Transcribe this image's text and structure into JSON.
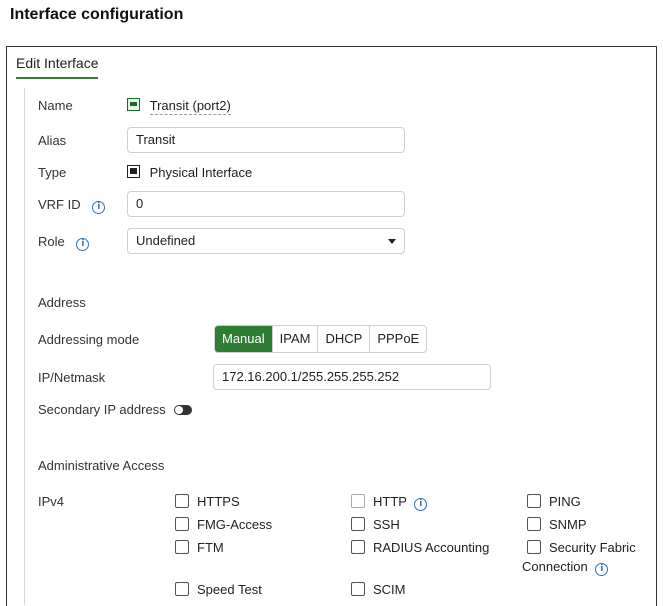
{
  "heading": "Interface configuration",
  "tab": {
    "label": "Edit Interface"
  },
  "fields": {
    "name_label": "Name",
    "name_value": "Transit (port2)",
    "alias_label": "Alias",
    "alias_value": "Transit",
    "type_label": "Type",
    "type_value": "Physical Interface",
    "vrf_label": "VRF ID",
    "vrf_value": "0",
    "role_label": "Role",
    "role_value": "Undefined"
  },
  "address": {
    "section_label": "Address",
    "mode_label": "Addressing mode",
    "modes": [
      "Manual",
      "IPAM",
      "DHCP",
      "PPPoE"
    ],
    "selected_mode": "Manual",
    "ipmask_label": "IP/Netmask",
    "ipmask_value": "172.16.200.1/255.255.255.252",
    "secondary_label": "Secondary IP address",
    "secondary_enabled": false
  },
  "admin": {
    "section_label": "Administrative Access",
    "ipv4_label": "IPv4",
    "options": {
      "https": "HTTPS",
      "http": "HTTP",
      "ping": "PING",
      "fmg": "FMG-Access",
      "ssh": "SSH",
      "snmp": "SNMP",
      "ftm": "FTM",
      "radius": "RADIUS Accounting",
      "sfc_line1": "Security Fabric",
      "sfc_line2": "Connection",
      "speed": "Speed Test",
      "scim": "SCIM"
    }
  },
  "icons": {
    "info": "info-icon",
    "port": "port-icon",
    "physical": "physical-interface-icon",
    "dropdown": "chevron-down-icon",
    "toggle": "toggle-off-icon"
  },
  "colors": {
    "accent": "#2e7d32",
    "info": "#3b6fb6"
  }
}
